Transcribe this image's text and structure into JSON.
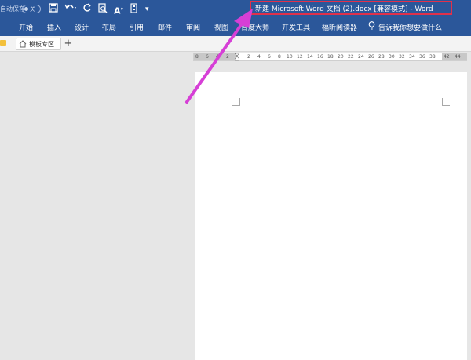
{
  "titlebar": {
    "autosave_label": "自动保存",
    "autosave_state": "关",
    "quick_access": [
      "save-icon",
      "undo-icon",
      "redo-icon",
      "print-preview-icon",
      "font-size-icon",
      "customize-icon"
    ],
    "title": "新建 Microsoft Word 文档 (2).docx [兼容模式]  -  Word"
  },
  "ribbon": {
    "tabs": [
      "开始",
      "插入",
      "设计",
      "布局",
      "引用",
      "邮件",
      "审阅",
      "视图",
      "百度大师",
      "开发工具",
      "福昕阅读器"
    ],
    "tell_me": "告诉我你想要做什么"
  },
  "docstrip": {
    "tab_label": "模板专区",
    "add_label": "+"
  },
  "ruler": {
    "ticks": [
      "8",
      "6",
      "4",
      "2",
      "2",
      "4",
      "6",
      "8",
      "10",
      "12",
      "14",
      "16",
      "18",
      "20",
      "22",
      "24",
      "26",
      "28",
      "30",
      "32",
      "34",
      "36",
      "38",
      "42",
      "44"
    ]
  },
  "colors": {
    "ribbon": "#2b579a",
    "highlight_box": "#e0314b",
    "arrow": "#d63fd6"
  }
}
